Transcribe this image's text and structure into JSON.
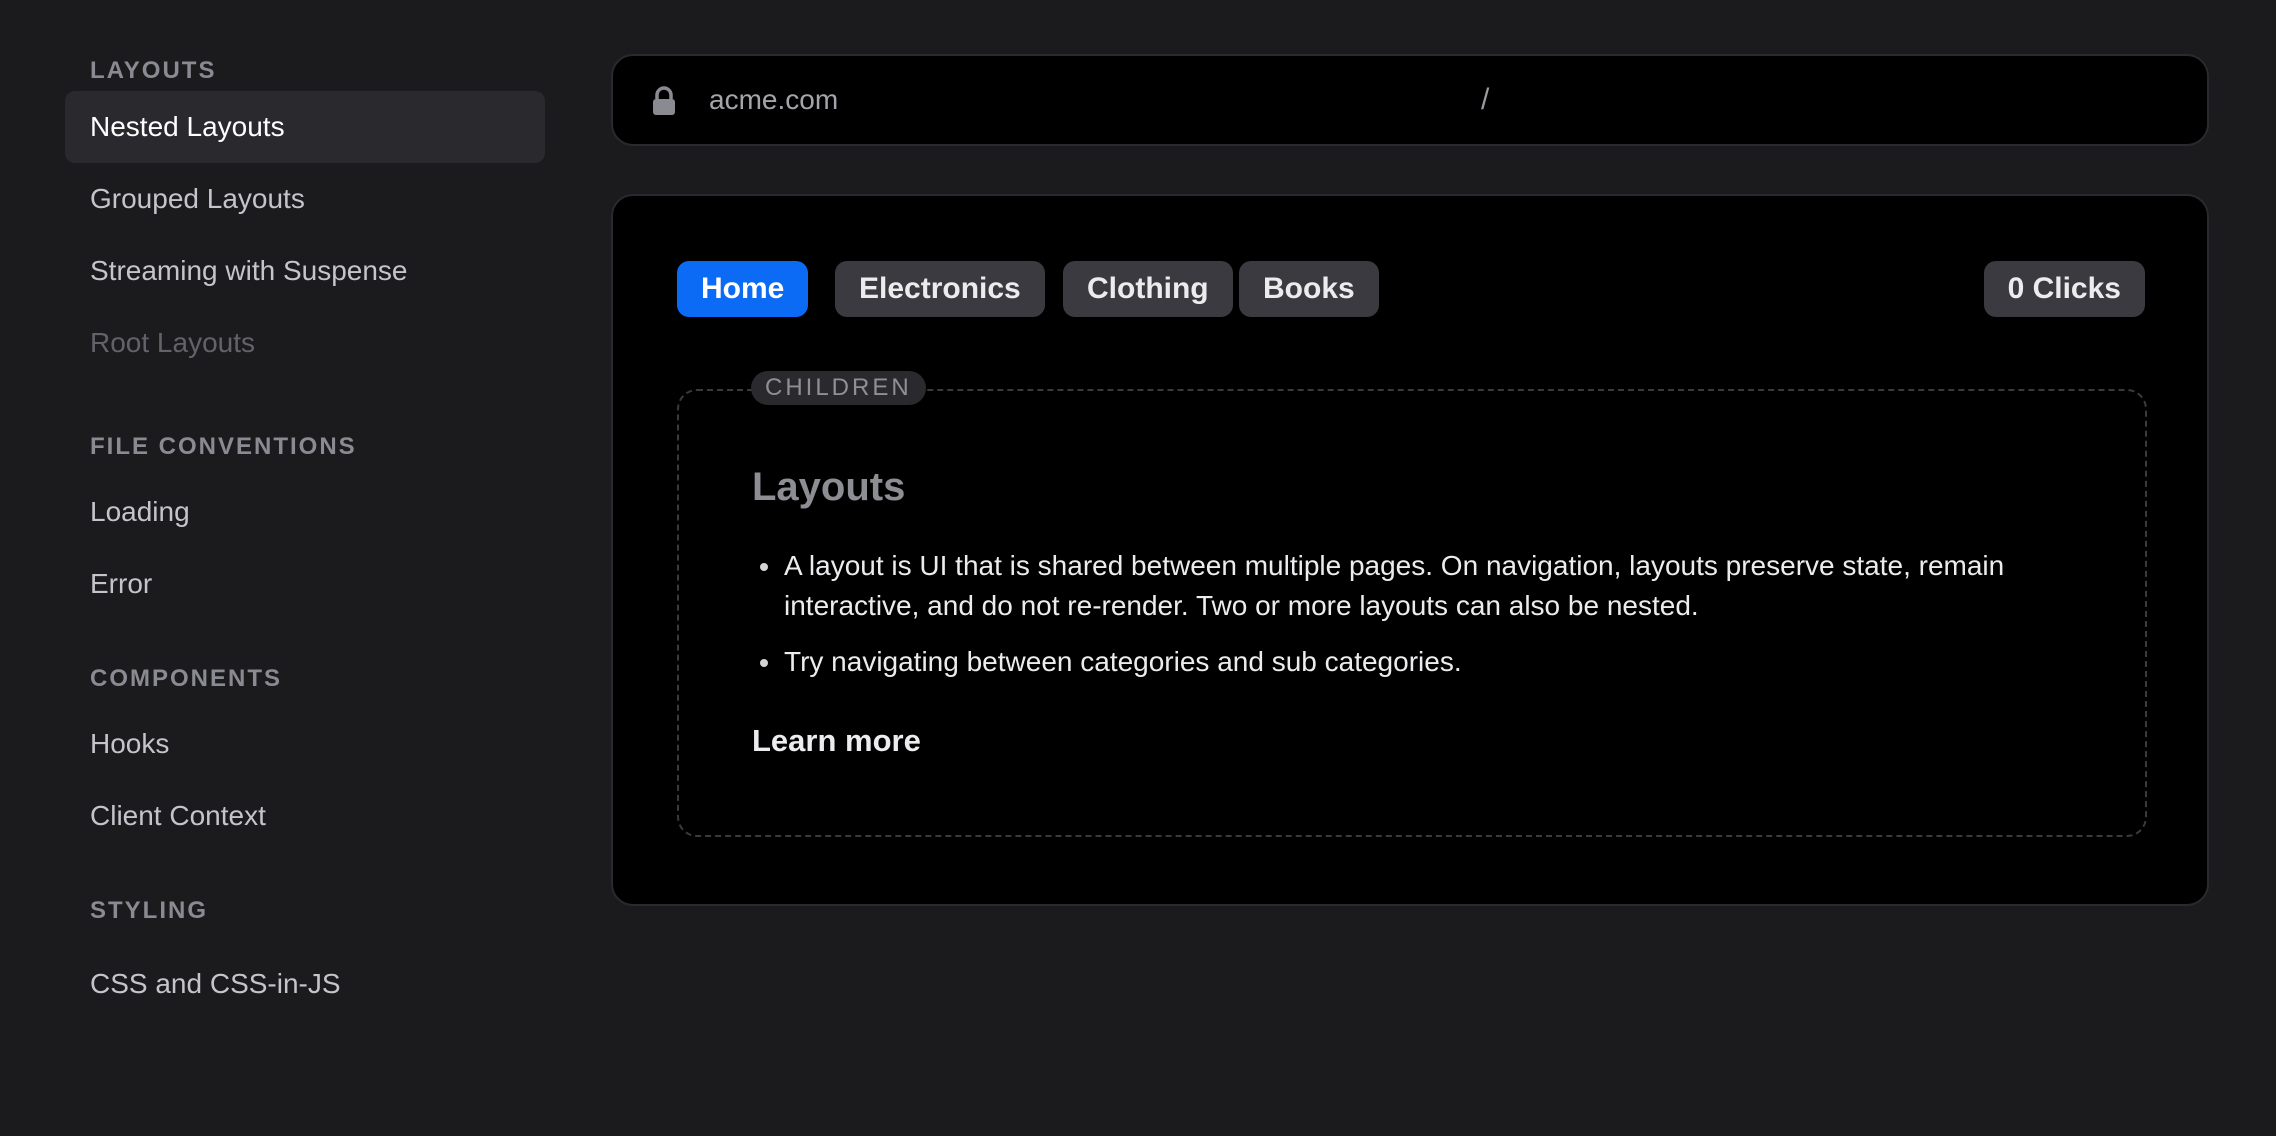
{
  "sidebar": {
    "sections": [
      {
        "title": "LAYOUTS",
        "items": [
          "Nested Layouts",
          "Grouped Layouts",
          "Streaming with Suspense",
          "Root Layouts"
        ]
      },
      {
        "title": "FILE CONVENTIONS",
        "items": [
          "Loading",
          "Error"
        ]
      },
      {
        "title": "COMPONENTS",
        "items": [
          "Hooks",
          "Client Context"
        ]
      },
      {
        "title": "STYLING",
        "items": [
          "CSS and CSS-in-JS"
        ]
      }
    ],
    "active_item": "Nested Layouts",
    "disabled_item": "Root Layouts"
  },
  "addressbar": {
    "icon": "lock-icon",
    "domain": "acme.com",
    "path_separator": "/"
  },
  "tabs": {
    "items": [
      "Home",
      "Electronics",
      "Clothing",
      "Books"
    ],
    "active": "Home",
    "clicks_label": "0 Clicks"
  },
  "children": {
    "label": "CHILDREN",
    "heading": "Layouts",
    "bullets": [
      "A layout is UI that is shared between multiple pages. On navigation, layouts preserve state, remain interactive, and do not re-render. Two or more layouts can also be nested.",
      "Try navigating between categories and sub categories."
    ],
    "link_label": "Learn more"
  },
  "colors": {
    "page_bg": "#1b1b1d",
    "panel_bg": "#000000",
    "accent": "#0b6bf5",
    "tab_bg": "#3a3a40"
  }
}
